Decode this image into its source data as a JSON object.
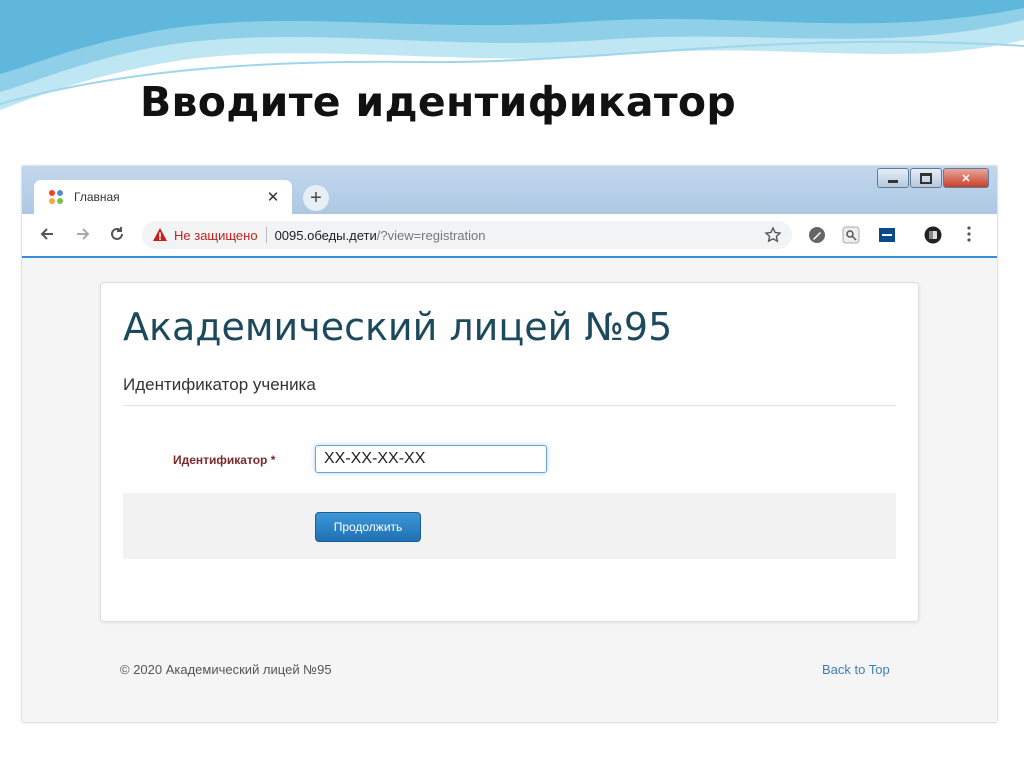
{
  "slide": {
    "title": "Вводите идентификатор"
  },
  "browser": {
    "tab": {
      "title": "Главная"
    },
    "address": {
      "security_label": "Не защищено",
      "host": "0095.обеды.дети",
      "path": "/?view=registration"
    }
  },
  "page": {
    "site_title": "Академический лицей №95",
    "subtitle": "Идентификатор ученика",
    "field": {
      "label": "Идентификатор *",
      "value": "XX-XX-XX-XX"
    },
    "continue_label": "Продолжить",
    "footer": {
      "copyright": "© 2020 Академический лицей №95",
      "back_to_top": "Back to Top"
    }
  },
  "colors": {
    "accent": "#1f71b3",
    "heading": "#1c4a5c",
    "required_label": "#7a2a2a",
    "warning": "#c5221f"
  }
}
